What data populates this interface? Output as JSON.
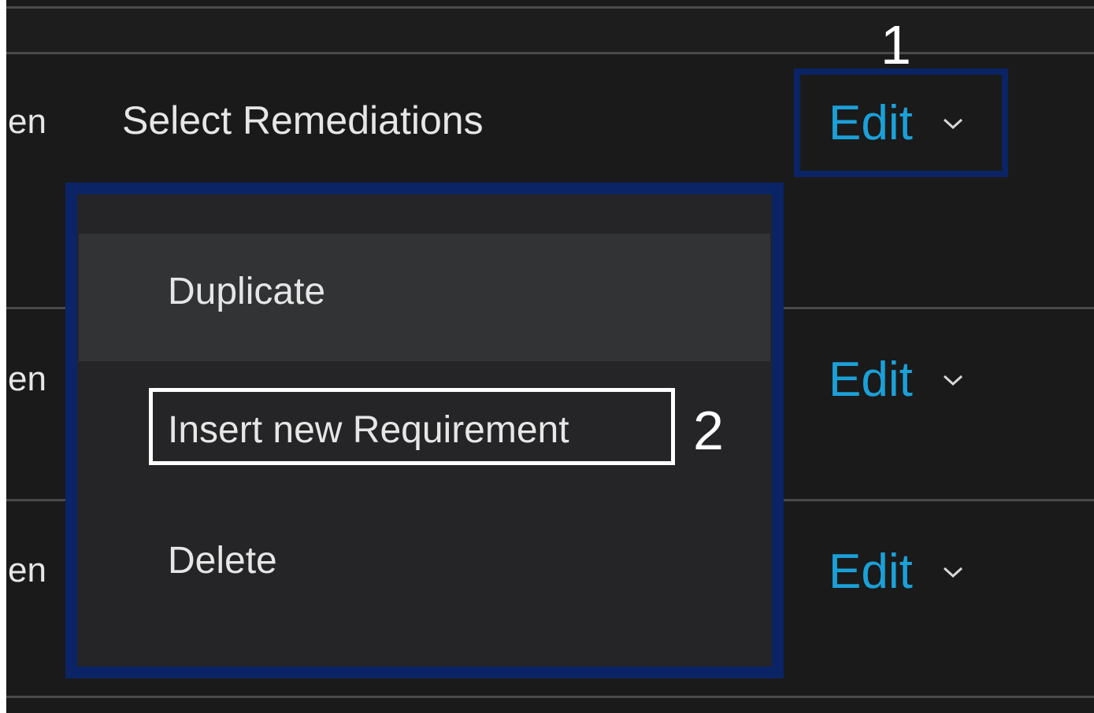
{
  "rows": [
    {
      "stub": "en",
      "label": "Select Remediations",
      "action_label": "Edit"
    },
    {
      "stub": "en",
      "action_label": "Edit"
    },
    {
      "stub": "en",
      "action_label": "Edit"
    }
  ],
  "dropdown_menu": {
    "items": [
      {
        "label": "Duplicate",
        "state": "hovered"
      },
      {
        "label": "Insert new Requirement"
      },
      {
        "label": "Delete"
      }
    ]
  },
  "callouts": [
    {
      "number": "1"
    },
    {
      "number": "2"
    }
  ],
  "colors": {
    "background": "#1a1a1a",
    "link_blue": "#1ba0d8",
    "callout_box": "#0b2466",
    "text": "#e6e6e6",
    "menu_bg": "#252527",
    "menu_hover": "#323335"
  },
  "icons": {
    "dropdown": "chevron-down-icon"
  }
}
